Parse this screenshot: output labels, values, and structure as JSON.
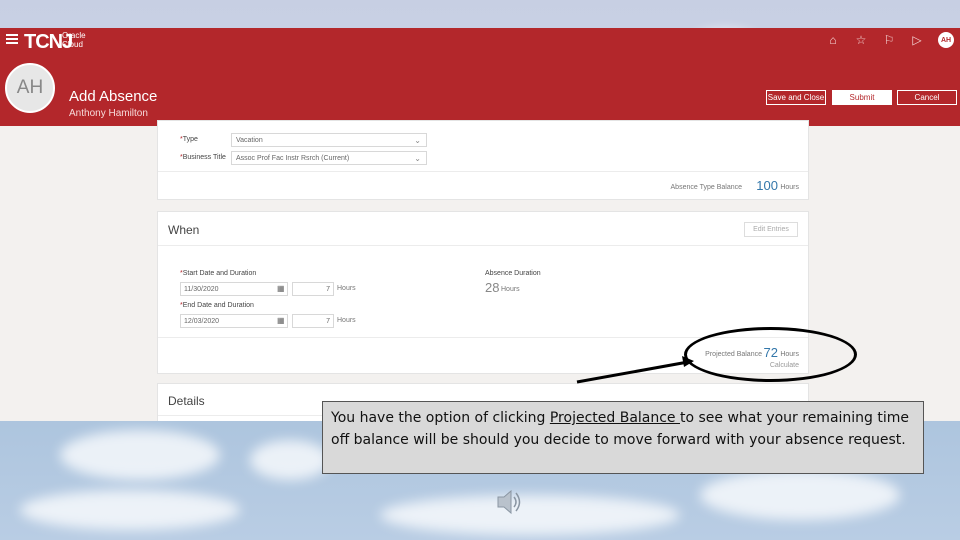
{
  "app": {
    "logo": "TCNJ",
    "logo_sub": "Oracle Cloud",
    "avatar_small": "AH",
    "top_icons": [
      "home-icon",
      "star-icon",
      "flag-icon",
      "play-icon"
    ]
  },
  "header": {
    "avatar_initials": "AH",
    "title": "Add Absence",
    "subtitle": "Anthony Hamilton",
    "save_close_label": "Save and Close",
    "submit_label": "Submit",
    "cancel_label": "Cancel"
  },
  "type_card": {
    "type_label": "Type",
    "type_value": "Vacation",
    "business_title_label": "Business Title",
    "business_title_value": "Assoc Prof Fac Instr Rsrch (Current)",
    "balance_label": "Absence Type Balance",
    "balance_value": "100",
    "balance_unit": "Hours"
  },
  "when_card": {
    "title": "When",
    "edit_entries_label": "Edit Entries",
    "start_label": "Start Date and Duration",
    "start_date": "11/30/2020",
    "start_hours": "7",
    "start_unit": "Hours",
    "end_label": "End Date and Duration",
    "end_date": "12/03/2020",
    "end_hours": "7",
    "end_unit": "Hours",
    "absence_duration_label": "Absence Duration",
    "absence_duration_value": "28",
    "absence_duration_unit": "Hours",
    "projected_label": "Projected Balance",
    "projected_value": "72",
    "projected_unit": "Hours",
    "calculate_label": "Calculate"
  },
  "details_card": {
    "title": "Details"
  },
  "callout": {
    "text_before": "You have the option of clicking ",
    "link_text": "Projected Balance ",
    "text_after": "to see what your remaining time off balance will be should you decide to move forward with your absence request."
  },
  "colors": {
    "brand_red": "#b3272b",
    "accent_blue": "#3377aa"
  }
}
